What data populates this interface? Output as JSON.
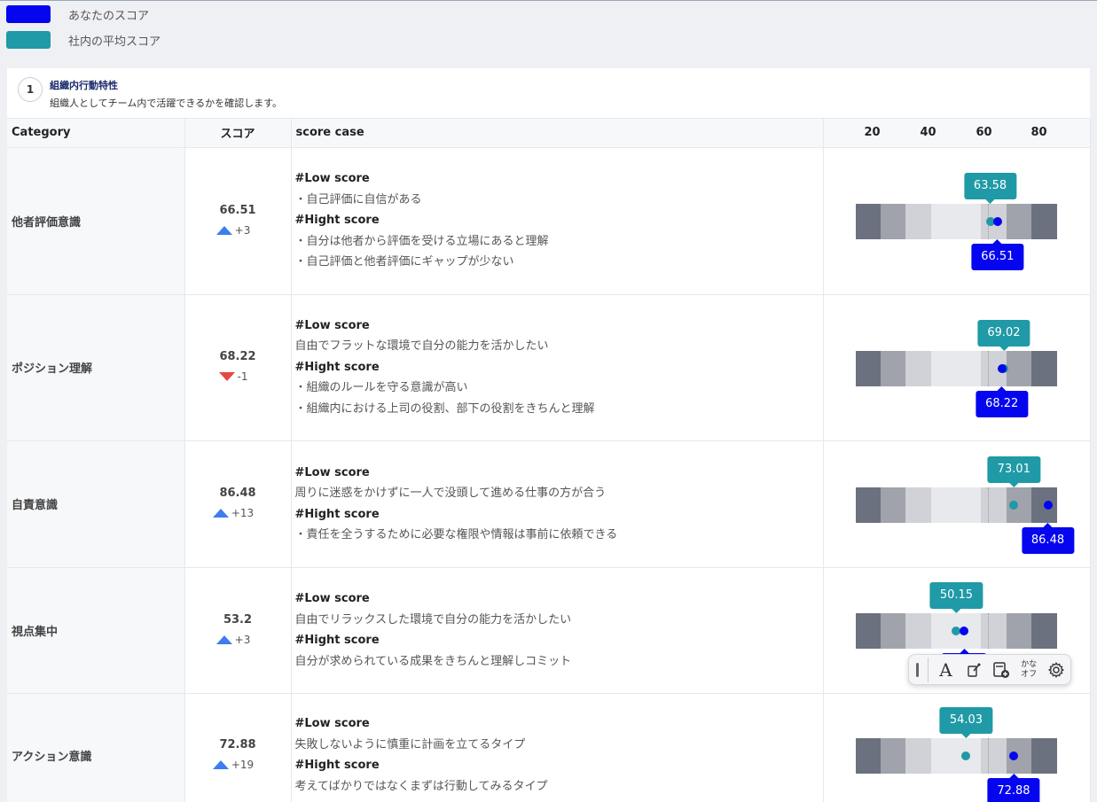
{
  "colors": {
    "you": "#0505f0",
    "avg": "#1f9aa6"
  },
  "legend": {
    "you": "あなたのスコア",
    "avg": "社内の平均スコア"
  },
  "section": {
    "number": "1",
    "title": "組織内行動特性",
    "subtitle": "組織人としてチーム内で活躍できるかを確認します。"
  },
  "table": {
    "headers": {
      "category": "Category",
      "score": "スコア",
      "case": "score case"
    },
    "ticks": [
      "20",
      "40",
      "60",
      "80"
    ],
    "low_label": "#Low score",
    "high_label": "#Hight score",
    "rows": [
      {
        "category": "他者評価意識",
        "score": "66.51",
        "delta_dir": "up",
        "delta": "+3",
        "low": [
          "・自己評価に自信がある"
        ],
        "high": [
          "・自分は他者から評価を受ける立場にあると理解",
          "・自己評価と他者評価にギャップが少ない"
        ],
        "avg_score": "63.58",
        "you_score": "66.51"
      },
      {
        "category": "ポジション理解",
        "score": "68.22",
        "delta_dir": "down",
        "delta": "-1",
        "low": [
          "自由でフラットな環境で自分の能力を活かしたい"
        ],
        "high": [
          "・組織のルールを守る意識が高い",
          "・組織内における上司の役割、部下の役割をきちんと理解"
        ],
        "avg_score": "69.02",
        "you_score": "68.22"
      },
      {
        "category": "自責意識",
        "score": "86.48",
        "delta_dir": "up",
        "delta": "+13",
        "low": [
          "周りに迷惑をかけずに一人で没頭して進める仕事の方が合う"
        ],
        "high": [
          "・責任を全うするために必要な権限や情報は事前に依頼できる"
        ],
        "avg_score": "73.01",
        "you_score": "86.48"
      },
      {
        "category": "視点集中",
        "score": "53.2",
        "delta_dir": "up",
        "delta": "+3",
        "low": [
          "自由でリラックスした環境で自分の能力を活かしたい"
        ],
        "high": [
          "自分が求められている成果をきちんと理解しコミット"
        ],
        "avg_score": "50.15",
        "you_score": "53.2"
      },
      {
        "category": "アクション意識",
        "score": "72.88",
        "delta_dir": "up",
        "delta": "+19",
        "low": [
          "失敗しないように慎重に計画を立てるタイプ"
        ],
        "high": [
          "考えてばかりではなくまずは行動してみるタイプ"
        ],
        "avg_score": "54.03",
        "you_score": "72.88"
      }
    ]
  },
  "floating_toolbar": {
    "icons": [
      "grip-icon",
      "font-icon",
      "pen-icon",
      "add-card-icon",
      "kana-toggle-icon",
      "gear-icon"
    ],
    "text_icon": "A",
    "kana_label_top": "かな",
    "kana_label_bottom": "オフ"
  }
}
